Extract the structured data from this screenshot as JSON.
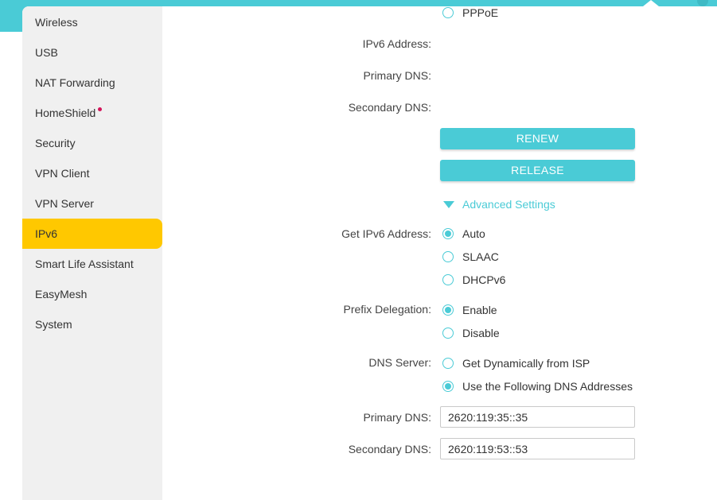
{
  "sidebar": {
    "items": [
      {
        "label": "Wireless"
      },
      {
        "label": "USB"
      },
      {
        "label": "NAT Forwarding"
      },
      {
        "label": "HomeShield"
      },
      {
        "label": "Security"
      },
      {
        "label": "VPN Client"
      },
      {
        "label": "VPN Server"
      },
      {
        "label": "IPv6",
        "active": true
      },
      {
        "label": "Smart Life Assistant"
      },
      {
        "label": "EasyMesh"
      },
      {
        "label": "System"
      }
    ]
  },
  "connection": {
    "pppoe_option": "PPPoE",
    "ipv6_address_label": "IPv6 Address:",
    "primary_dns_label": "Primary DNS:",
    "secondary_dns_label": "Secondary DNS:"
  },
  "buttons": {
    "renew": "RENEW",
    "release": "RELEASE"
  },
  "advanced": {
    "toggle_label": "Advanced Settings",
    "get_ipv6_label": "Get IPv6 Address:",
    "get_ipv6_options": [
      "Auto",
      "SLAAC",
      "DHCPv6"
    ],
    "get_ipv6_selected": "Auto",
    "prefix_label": "Prefix Delegation:",
    "prefix_options": [
      "Enable",
      "Disable"
    ],
    "prefix_selected": "Enable",
    "dns_server_label": "DNS Server:",
    "dns_server_options": [
      "Get Dynamically from ISP",
      "Use the Following DNS Addresses"
    ],
    "dns_server_selected": "Use the Following DNS Addresses",
    "primary_dns_label": "Primary DNS:",
    "primary_dns_value": "2620:119:35::35",
    "secondary_dns_label": "Secondary DNS:",
    "secondary_dns_value": "2620:119:53::53"
  },
  "colors": {
    "accent": "#4acbd6",
    "active_nav": "#ffc800",
    "new_dot": "#d4145a"
  }
}
